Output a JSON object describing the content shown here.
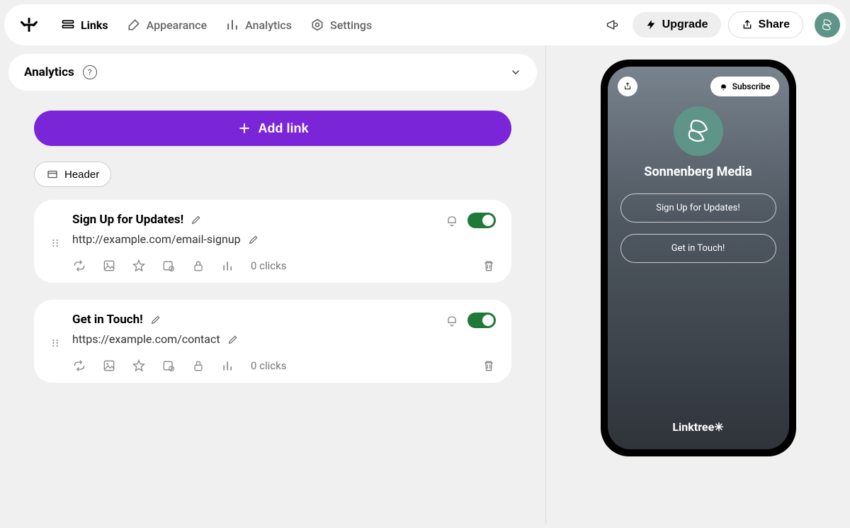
{
  "nav": {
    "tabs": {
      "links": "Links",
      "appearance": "Appearance",
      "analytics": "Analytics",
      "settings": "Settings"
    },
    "upgrade": "Upgrade",
    "share": "Share"
  },
  "panel": {
    "analytics_label": "Analytics"
  },
  "actions": {
    "add_link": "Add link",
    "header": "Header"
  },
  "links": [
    {
      "title": "Sign Up for Updates!",
      "url": "http://example.com/email-signup",
      "clicks": "0 clicks",
      "enabled": true
    },
    {
      "title": "Get in Touch!",
      "url": "https://example.com/contact",
      "clicks": "0 clicks",
      "enabled": true
    }
  ],
  "preview": {
    "subscribe": "Subscribe",
    "name": "Sonnenberg Media",
    "links": [
      "Sign Up for Updates!",
      "Get in Touch!"
    ],
    "footer_brand": "Linktree",
    "footer_symbol": "✳"
  }
}
